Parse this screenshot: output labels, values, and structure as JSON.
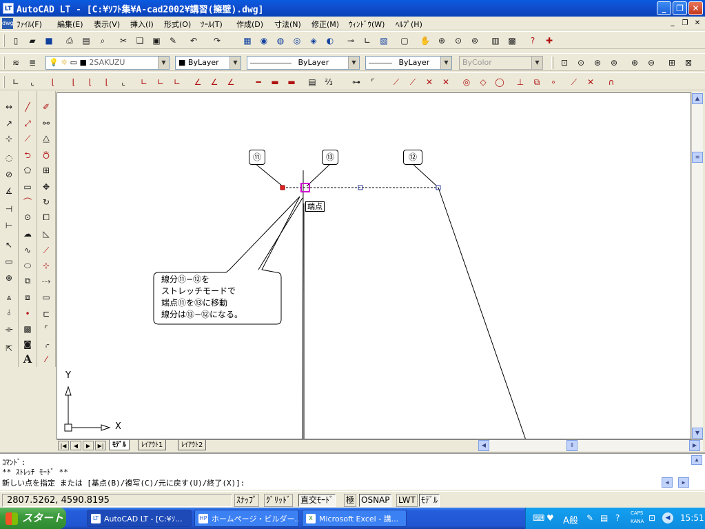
{
  "window": {
    "app_icon": "LT",
    "title": "AutoCAD LT - [C:¥ｿﾌﾄ集¥A-cad2002¥講習(擁壁).dwg]",
    "minimize": "_",
    "restore": "❐",
    "close": "✕"
  },
  "menubar": {
    "doc_icon": "dwg",
    "items": [
      "ﾌｧｲﾙ(F)",
      "編集(E)",
      "表示(V)",
      "挿入(I)",
      "形式(O)",
      "ﾂｰﾙ(T)",
      "作成(D)",
      "寸法(N)",
      "修正(M)",
      "ｳｨﾝﾄﾞｳ(W)",
      "ﾍﾙﾌﾟ(H)"
    ],
    "mdi": [
      "_",
      "❐",
      "✕"
    ]
  },
  "layer_toolbar": {
    "layer_name": "2SAKUZU",
    "color": "ByLayer",
    "linetype": "ByLayer",
    "lineweight": "ByLayer",
    "plotstyle": "ByColor"
  },
  "drawing": {
    "point_labels": [
      "⑪",
      "⑬",
      "⑫"
    ],
    "snap_tip": "端点",
    "balloon_lines": [
      "線分⑪−⑫を",
      "ストレッチモードで",
      "端点⑪を⑬に移動",
      "線分は⑬−⑫になる。"
    ],
    "ucs_x": "X",
    "ucs_y": "Y"
  },
  "tabs": {
    "nav": [
      "|◀",
      "◀",
      "▶",
      "▶|"
    ],
    "items": [
      "ﾓﾃﾞﾙ",
      "ﾚｲｱｳﾄ1",
      "ﾚｲｱｳﾄ2"
    ],
    "active": 0
  },
  "command": {
    "line1": "ｺﾏﾝﾄﾞ:",
    "line2": "** ｽﾄﾚｯﾁ ﾓｰﾄﾞ **",
    "line3": "新しい点を指定 または [基点(B)/複写(C)/元に戻す(U)/終了(X)]:"
  },
  "statusbar": {
    "coords": "2807.5262, 4590.8195",
    "buttons": [
      "ｽﾅｯﾌﾟ",
      "ｸﾞﾘｯﾄﾞ",
      "直交ﾓｰﾄﾞ",
      "極",
      "OSNAP",
      "LWT",
      "ﾓﾃﾞﾙ"
    ],
    "on": [
      false,
      false,
      true,
      false,
      true,
      false,
      true
    ]
  },
  "taskbar": {
    "start": "スタート",
    "tasks": [
      "AutoCAD LT - [C:¥ｿ...",
      "ホームページ・ビルダー...",
      "Microsoft Excel - 講..."
    ],
    "tray_ime": "A般",
    "tray_caps": "CAPS",
    "tray_kana": "KANA",
    "clock": "15:51"
  }
}
